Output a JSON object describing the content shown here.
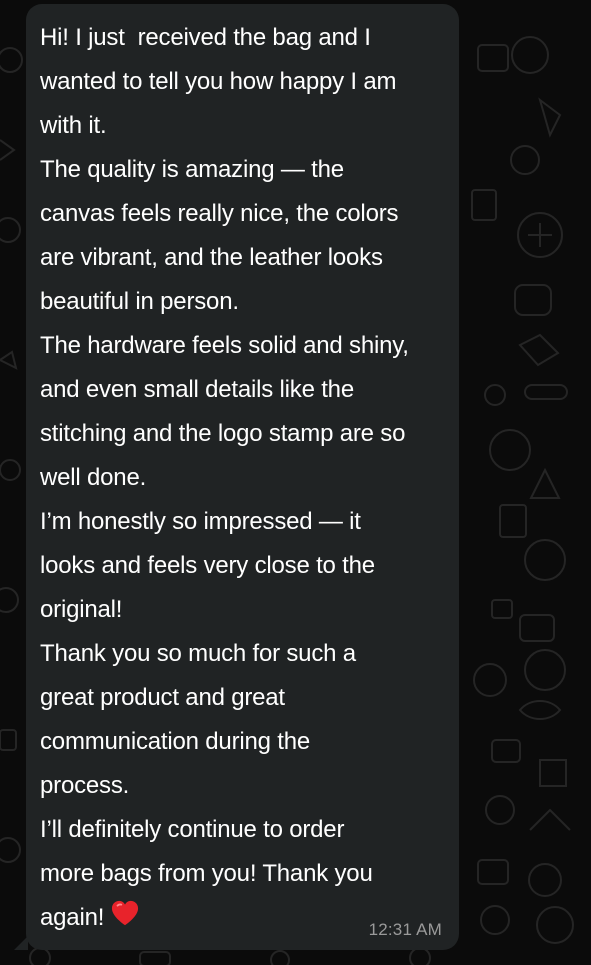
{
  "message": {
    "lines": [
      "Hi! I just  received the bag and I",
      "wanted to tell you how happy I am",
      "with it.",
      "The quality is amazing — the",
      "canvas feels really nice, the colors",
      "are vibrant, and the leather looks",
      "beautiful in person.",
      "The hardware feels solid and shiny,",
      "and even small details like the",
      "stitching and the logo stamp are so",
      "well done.",
      "I’m honestly so impressed — it",
      "looks and feels very close to the",
      "original!",
      "Thank you so much for such a",
      "great product and great",
      "communication during the",
      "process.",
      "I’ll definitely continue to order",
      "more bags from you! Thank you",
      "again!"
    ],
    "emoji": "heart-icon",
    "time": "12:31 AM"
  },
  "colors": {
    "background": "#0b0b0b",
    "bubble": "#202324",
    "text": "#ffffff",
    "timestamp": "#9a9a9a",
    "heart": "#e8232b",
    "doodle": "#262626"
  }
}
